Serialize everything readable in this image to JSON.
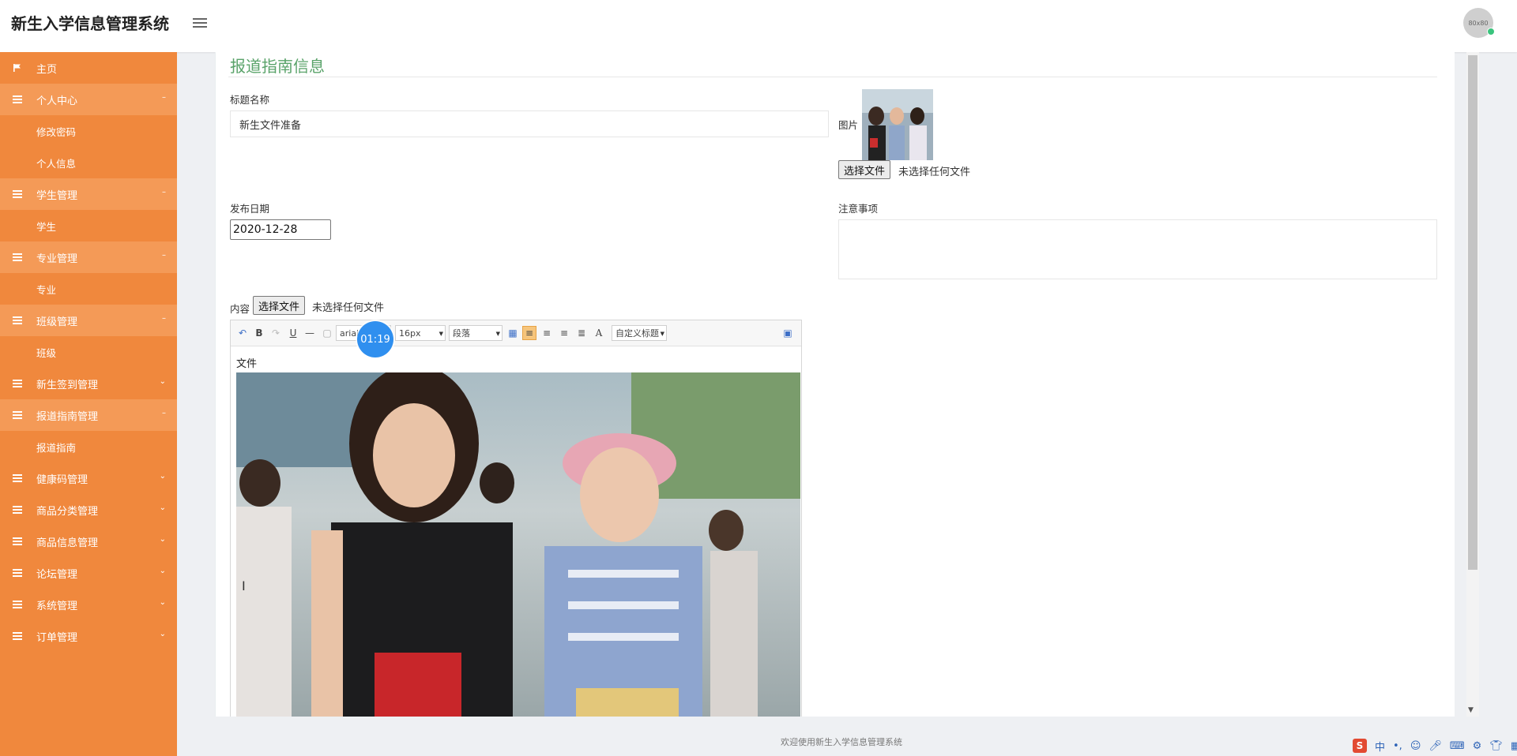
{
  "app": {
    "title": "新生入学信息管理系统",
    "avatar_text": "80x80"
  },
  "sidebar": {
    "items": [
      {
        "label": "主页",
        "icon": "flag-icon"
      },
      {
        "label": "个人中心",
        "icon": "list-icon",
        "expanded": true
      },
      {
        "label": "修改密码",
        "sub": true
      },
      {
        "label": "个人信息",
        "sub": true
      },
      {
        "label": "学生管理",
        "icon": "list-icon",
        "expanded": true
      },
      {
        "label": "学生",
        "sub": true
      },
      {
        "label": "专业管理",
        "icon": "list-icon",
        "expanded": true
      },
      {
        "label": "专业",
        "sub": true
      },
      {
        "label": "班级管理",
        "icon": "list-icon",
        "expanded": true
      },
      {
        "label": "班级",
        "sub": true
      },
      {
        "label": "新生签到管理",
        "icon": "list-icon"
      },
      {
        "label": "报道指南管理",
        "icon": "list-icon",
        "expanded": true
      },
      {
        "label": "报道指南",
        "sub": true
      },
      {
        "label": "健康码管理",
        "icon": "list-icon"
      },
      {
        "label": "商品分类管理",
        "icon": "list-icon"
      },
      {
        "label": "商品信息管理",
        "icon": "list-icon"
      },
      {
        "label": "论坛管理",
        "icon": "list-icon"
      },
      {
        "label": "系统管理",
        "icon": "list-icon"
      },
      {
        "label": "订单管理",
        "icon": "list-icon"
      }
    ]
  },
  "form": {
    "section_title": "报道指南信息",
    "title_label": "标题名称",
    "title_value": "新生文件准备",
    "image_label": "图片",
    "file_button": "选择文件",
    "file_none": "未选择任何文件",
    "date_label": "发布日期",
    "date_value": "2020-12-28",
    "notes_label": "注意事项",
    "content_label": "内容"
  },
  "editor": {
    "font_family": "arial",
    "font_size": "16px",
    "paragraph": "段落",
    "custom_title": "自定义标题",
    "text_line": "文件",
    "timer": "01:19"
  },
  "footer": {
    "text": "欢迎使用新生入学信息管理系统"
  },
  "tray": {
    "ime_mode": "中",
    "logo": "S"
  }
}
